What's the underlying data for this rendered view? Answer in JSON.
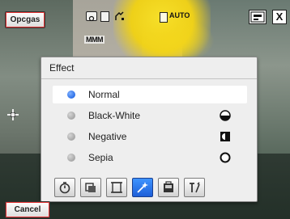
{
  "softkeys": {
    "top_left": "Opcgas",
    "bottom_left": "Cancel"
  },
  "status_bar": {
    "flash_mode": "AUTO",
    "quality_indicator": "MMM",
    "close_glyph": "X"
  },
  "effect_menu": {
    "title": "Effect",
    "selected_index": 0,
    "items": [
      {
        "label": "Normal",
        "preview_icon": "none"
      },
      {
        "label": "Black-White",
        "preview_icon": "half-circle-bw-icon"
      },
      {
        "label": "Negative",
        "preview_icon": "negative-square-icon"
      },
      {
        "label": "Sepia",
        "preview_icon": "circle-outline-icon"
      }
    ]
  },
  "toolbar": {
    "active_index": 3,
    "tools": [
      {
        "icon": "timer-icon"
      },
      {
        "icon": "photo-size-icon"
      },
      {
        "icon": "frame-icon"
      },
      {
        "icon": "effect-wand-icon"
      },
      {
        "icon": "save-location-icon"
      },
      {
        "icon": "settings-tools-icon"
      }
    ]
  },
  "colors": {
    "accent_blue": "#2c6fe6",
    "panel_bg": "#eeeeee",
    "softkey_outline": "#e53232"
  }
}
